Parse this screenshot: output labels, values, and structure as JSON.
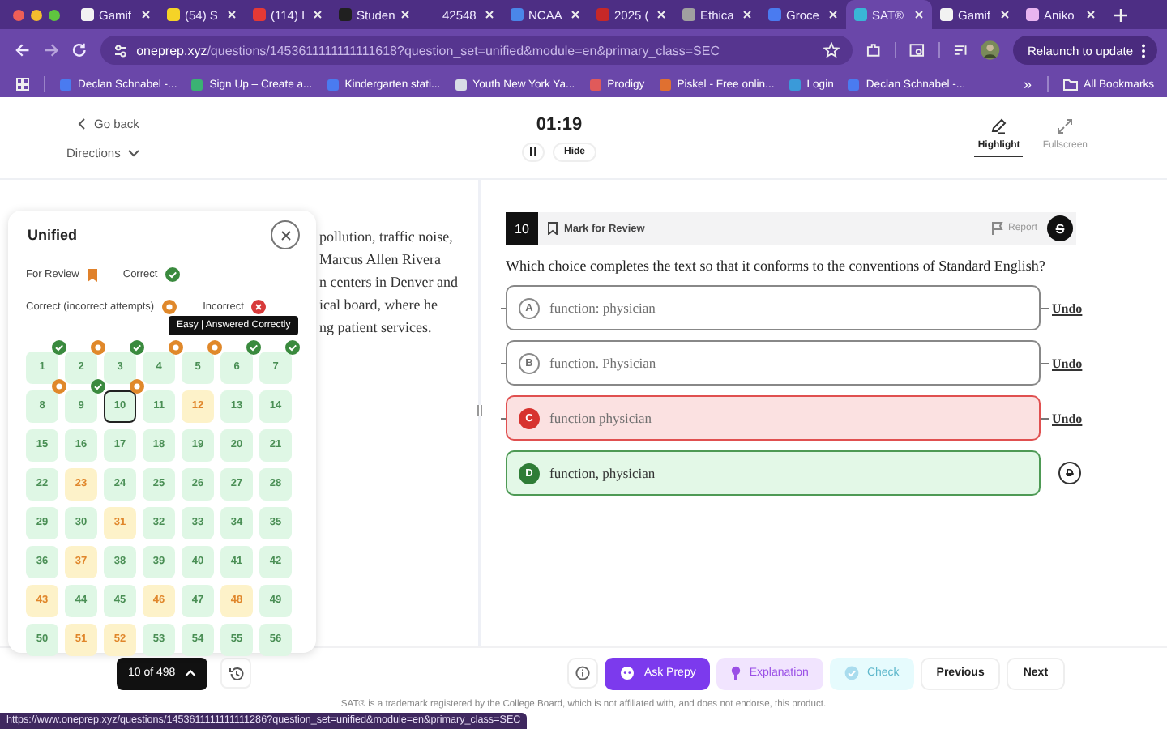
{
  "browser": {
    "tabs": [
      {
        "title": "Gamif",
        "selected": false,
        "color": "#f2f2f2"
      },
      {
        "title": "(54) S",
        "selected": false,
        "color": "#f5d327"
      },
      {
        "title": "(114) I",
        "selected": false,
        "color": "#e53935"
      },
      {
        "title": "Studen",
        "selected": false,
        "color": "#202020"
      },
      {
        "title": "42548",
        "selected": false
      },
      {
        "title": "NCAA",
        "selected": false,
        "color": "#4a86e8"
      },
      {
        "title": "2025 (",
        "selected": false,
        "color": "#c62828"
      },
      {
        "title": "Ethica",
        "selected": false,
        "color": "#a0a0a0"
      },
      {
        "title": "Groce",
        "selected": false,
        "color": "#4a7bf0"
      },
      {
        "title": "SAT®",
        "selected": true,
        "color": "#39b6d6"
      },
      {
        "title": "Gamif",
        "selected": false,
        "color": "#f2f2f2"
      },
      {
        "title": "Aniko",
        "selected": false,
        "color": "#e8b4f0"
      }
    ],
    "url_host": "oneprep.xyz",
    "url_path": "/questions/1453611111111111618?question_set=unified&module=en&primary_class=SEC",
    "relaunch": "Relaunch to update",
    "bookmarks": [
      {
        "label": "Declan Schnabel -...",
        "color": "#4a7bf0"
      },
      {
        "label": "Sign Up – Create a...",
        "color": "#3bb273"
      },
      {
        "label": "Kindergarten stati...",
        "color": "#4a7bf0"
      },
      {
        "label": "Youth New York Ya...",
        "color": "#d8dde6"
      },
      {
        "label": "Prodigy",
        "color": "#e05a5a"
      },
      {
        "label": "Piskel - Free onlin...",
        "color": "#e07030"
      },
      {
        "label": "Login",
        "color": "#3a9ad9"
      },
      {
        "label": "Declan Schnabel -...",
        "color": "#4a7bf0"
      }
    ],
    "more": "»",
    "all_bookmarks": "All Bookmarks",
    "status_url": "https://www.oneprep.xyz/questions/1453611111111111286?question_set=unified&module=en&primary_class=SEC"
  },
  "header": {
    "back": "Go back",
    "directions": "Directions",
    "timer": "01:19",
    "hide": "Hide",
    "tools": [
      {
        "label": "Highlight",
        "kind": "highlight",
        "selected": true
      },
      {
        "label": "Fullscreen",
        "kind": "fullscreen",
        "selected": false
      }
    ]
  },
  "passage": [
    "pollution, traffic noise,",
    "Marcus Allen Rivera",
    "n centers in Denver and",
    "ical board, where he",
    "ng patient services."
  ],
  "navigator": {
    "title": "Unified",
    "legend": [
      {
        "label": "For Review",
        "kind": "review"
      },
      {
        "label": "Correct",
        "kind": "correct"
      },
      {
        "label": "Correct (incorrect attempts)",
        "kind": "attempts"
      },
      {
        "label": "Incorrect",
        "kind": "incorrect"
      }
    ],
    "tooltip": "Easy | Answered Correctly",
    "questions": [
      {
        "number": "1",
        "kind": "correct",
        "check_badge": true,
        "ring_badge": false,
        "selected": false
      },
      {
        "number": "2",
        "kind": "correct",
        "check_badge": false,
        "ring_badge": true,
        "selected": false
      },
      {
        "number": "3",
        "kind": "correct",
        "check_badge": true,
        "ring_badge": false,
        "selected": false
      },
      {
        "number": "4",
        "kind": "correct",
        "check_badge": false,
        "ring_badge": true,
        "selected": false
      },
      {
        "number": "5",
        "kind": "correct",
        "check_badge": false,
        "ring_badge": true,
        "selected": false
      },
      {
        "number": "6",
        "kind": "correct",
        "check_badge": true,
        "ring_badge": false,
        "selected": false
      },
      {
        "number": "7",
        "kind": "correct",
        "check_badge": true,
        "ring_badge": false,
        "selected": false
      },
      {
        "number": "8",
        "kind": "correct",
        "check_badge": false,
        "ring_badge": true,
        "selected": false
      },
      {
        "number": "9",
        "kind": "correct",
        "check_badge": true,
        "ring_badge": false,
        "selected": false
      },
      {
        "number": "10",
        "kind": "correct",
        "check_badge": false,
        "ring_badge": true,
        "selected": true
      },
      {
        "number": "11",
        "kind": "correct",
        "check_badge": false,
        "ring_badge": false,
        "selected": false
      },
      {
        "number": "12",
        "kind": "incorrect",
        "check_badge": false,
        "ring_badge": false,
        "selected": false
      },
      {
        "number": "13",
        "kind": "correct",
        "check_badge": false,
        "ring_badge": false,
        "selected": false
      },
      {
        "number": "14",
        "kind": "correct",
        "check_badge": false,
        "ring_badge": false,
        "selected": false
      },
      {
        "number": "15",
        "kind": "correct",
        "check_badge": false,
        "ring_badge": false,
        "selected": false
      },
      {
        "number": "16",
        "kind": "correct",
        "check_badge": false,
        "ring_badge": false,
        "selected": false
      },
      {
        "number": "17",
        "kind": "correct",
        "check_badge": false,
        "ring_badge": false,
        "selected": false
      },
      {
        "number": "18",
        "kind": "correct",
        "check_badge": false,
        "ring_badge": false,
        "selected": false
      },
      {
        "number": "19",
        "kind": "correct",
        "check_badge": false,
        "ring_badge": false,
        "selected": false
      },
      {
        "number": "20",
        "kind": "correct",
        "check_badge": false,
        "ring_badge": false,
        "selected": false
      },
      {
        "number": "21",
        "kind": "correct",
        "check_badge": false,
        "ring_badge": false,
        "selected": false
      },
      {
        "number": "22",
        "kind": "correct",
        "check_badge": false,
        "ring_badge": false,
        "selected": false
      },
      {
        "number": "23",
        "kind": "incorrect",
        "check_badge": false,
        "ring_badge": false,
        "selected": false
      },
      {
        "number": "24",
        "kind": "correct",
        "check_badge": false,
        "ring_badge": false,
        "selected": false
      },
      {
        "number": "25",
        "kind": "correct",
        "check_badge": false,
        "ring_badge": false,
        "selected": false
      },
      {
        "number": "26",
        "kind": "correct",
        "check_badge": false,
        "ring_badge": false,
        "selected": false
      },
      {
        "number": "27",
        "kind": "correct",
        "check_badge": false,
        "ring_badge": false,
        "selected": false
      },
      {
        "number": "28",
        "kind": "correct",
        "check_badge": false,
        "ring_badge": false,
        "selected": false
      },
      {
        "number": "29",
        "kind": "correct",
        "check_badge": false,
        "ring_badge": false,
        "selected": false
      },
      {
        "number": "30",
        "kind": "correct",
        "check_badge": false,
        "ring_badge": false,
        "selected": false
      },
      {
        "number": "31",
        "kind": "incorrect",
        "check_badge": false,
        "ring_badge": false,
        "selected": false
      },
      {
        "number": "32",
        "kind": "correct",
        "check_badge": false,
        "ring_badge": false,
        "selected": false
      },
      {
        "number": "33",
        "kind": "correct",
        "check_badge": false,
        "ring_badge": false,
        "selected": false
      },
      {
        "number": "34",
        "kind": "correct",
        "check_badge": false,
        "ring_badge": false,
        "selected": false
      },
      {
        "number": "35",
        "kind": "correct",
        "check_badge": false,
        "ring_badge": false,
        "selected": false
      },
      {
        "number": "36",
        "kind": "correct",
        "check_badge": false,
        "ring_badge": false,
        "selected": false
      },
      {
        "number": "37",
        "kind": "incorrect",
        "check_badge": false,
        "ring_badge": false,
        "selected": false
      },
      {
        "number": "38",
        "kind": "correct",
        "check_badge": false,
        "ring_badge": false,
        "selected": false
      },
      {
        "number": "39",
        "kind": "correct",
        "check_badge": false,
        "ring_badge": false,
        "selected": false
      },
      {
        "number": "40",
        "kind": "correct",
        "check_badge": false,
        "ring_badge": false,
        "selected": false
      },
      {
        "number": "41",
        "kind": "correct",
        "check_badge": false,
        "ring_badge": false,
        "selected": false
      },
      {
        "number": "42",
        "kind": "correct",
        "check_badge": false,
        "ring_badge": false,
        "selected": false
      },
      {
        "number": "43",
        "kind": "incorrect",
        "check_badge": false,
        "ring_badge": false,
        "selected": false
      },
      {
        "number": "44",
        "kind": "correct",
        "check_badge": false,
        "ring_badge": false,
        "selected": false
      },
      {
        "number": "45",
        "kind": "correct",
        "check_badge": false,
        "ring_badge": false,
        "selected": false
      },
      {
        "number": "46",
        "kind": "incorrect",
        "check_badge": false,
        "ring_badge": false,
        "selected": false
      },
      {
        "number": "47",
        "kind": "correct",
        "check_badge": false,
        "ring_badge": false,
        "selected": false
      },
      {
        "number": "48",
        "kind": "incorrect",
        "check_badge": false,
        "ring_badge": false,
        "selected": false
      },
      {
        "number": "49",
        "kind": "correct",
        "check_badge": false,
        "ring_badge": false,
        "selected": false
      },
      {
        "number": "50",
        "kind": "correct",
        "check_badge": false,
        "ring_badge": false,
        "selected": false
      },
      {
        "number": "51",
        "kind": "incorrect",
        "check_badge": false,
        "ring_badge": false,
        "selected": false
      },
      {
        "number": "52",
        "kind": "incorrect",
        "check_badge": false,
        "ring_badge": false,
        "selected": false
      },
      {
        "number": "53",
        "kind": "correct",
        "check_badge": false,
        "ring_badge": false,
        "selected": false
      },
      {
        "number": "54",
        "kind": "correct",
        "check_badge": false,
        "ring_badge": false,
        "selected": false
      },
      {
        "number": "55",
        "kind": "correct",
        "check_badge": false,
        "ring_badge": false,
        "selected": false
      },
      {
        "number": "56",
        "kind": "correct",
        "check_badge": false,
        "ring_badge": false,
        "selected": false
      }
    ],
    "progress": "10 of 498"
  },
  "question": {
    "number": "10",
    "mark_label": "Mark for Review",
    "report": "Report",
    "strike_toggle": "S",
    "prompt": "Which choice completes the text so that it conforms to the conventions of Standard English?",
    "choices": [
      {
        "letter": "A",
        "text": "function: physician",
        "kind": "neutral",
        "eliminated": true,
        "action_label": "Undo"
      },
      {
        "letter": "B",
        "text": "function. Physician",
        "kind": "neutral",
        "eliminated": true,
        "action_label": "Undo"
      },
      {
        "letter": "C",
        "text": "function physician",
        "kind": "incorrect",
        "eliminated": true,
        "action_label": "Undo"
      },
      {
        "letter": "D",
        "text": "function, physician",
        "kind": "correct",
        "eliminated": false,
        "action_label": "D"
      }
    ]
  },
  "actions": [
    {
      "label": "Ask Prepy",
      "kind": "ask",
      "disabled": false
    },
    {
      "label": "Explanation",
      "kind": "explanation",
      "disabled": false
    },
    {
      "label": "Check",
      "kind": "check",
      "disabled": true
    },
    {
      "label": "Previous",
      "kind": "nav",
      "disabled": false
    },
    {
      "label": "Next",
      "kind": "nav",
      "disabled": false
    }
  ],
  "footer": "SAT® is a trademark registered by the College Board, which is not affiliated with, and does not endorse, this product."
}
